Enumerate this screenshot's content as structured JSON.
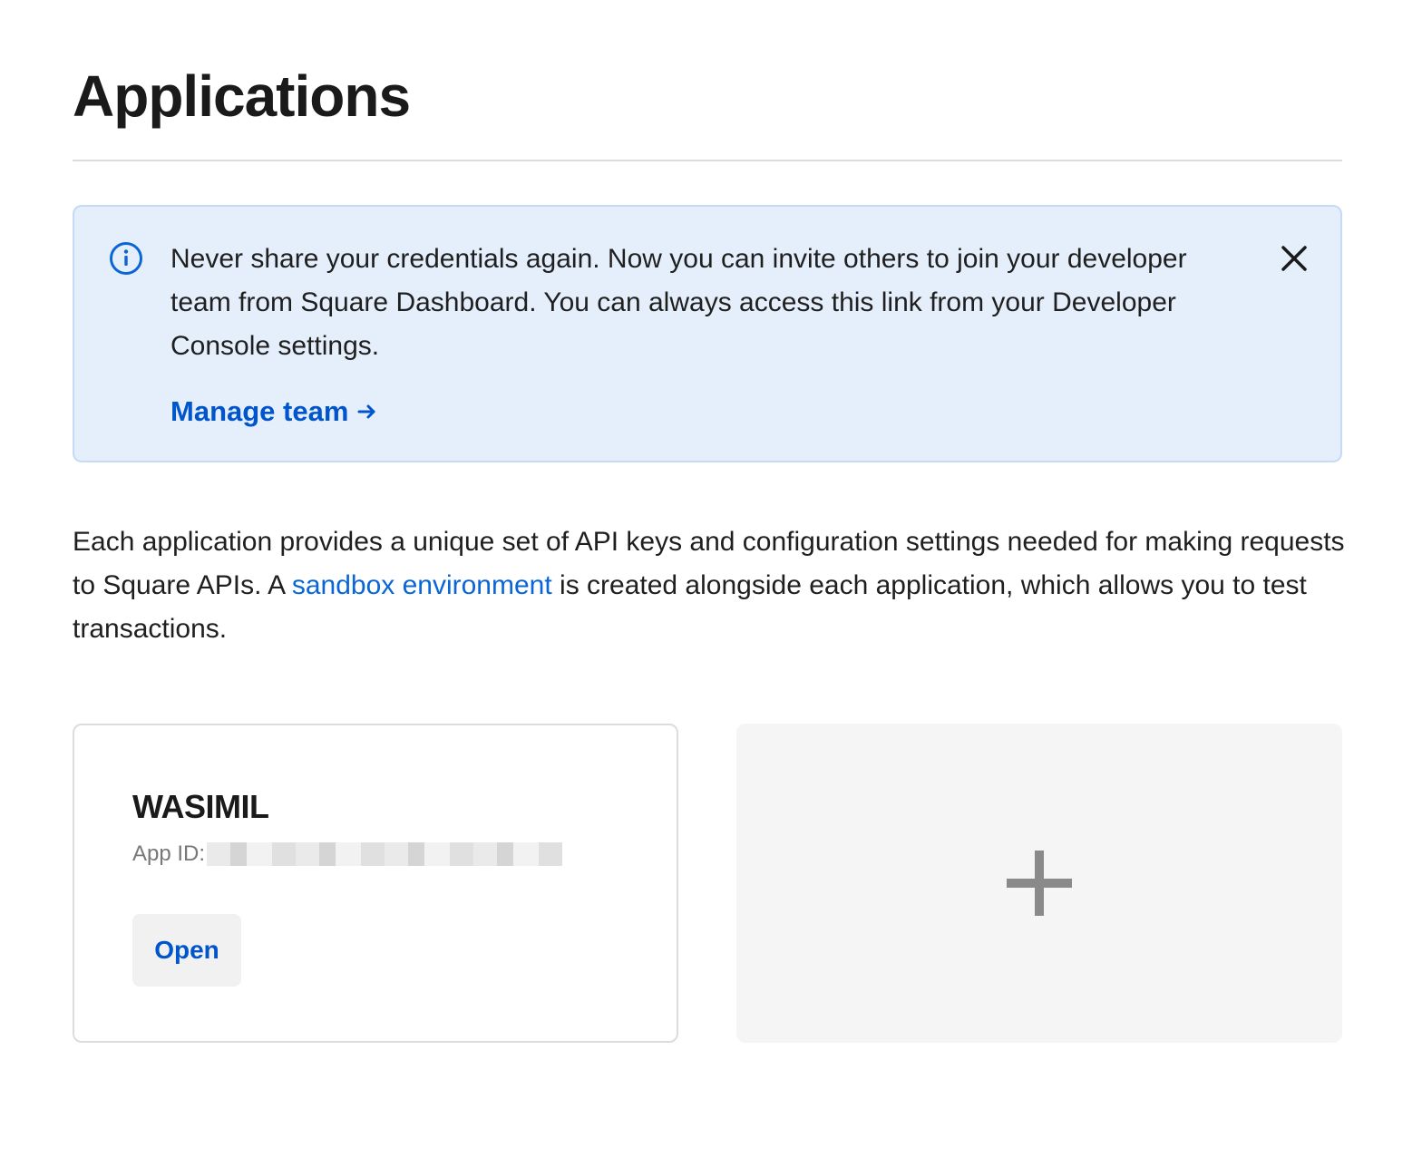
{
  "header": {
    "title": "Applications"
  },
  "banner": {
    "text": "Never share your credentials again. Now you can invite others to join your developer team from Square Dashboard. You can always access this link from your Developer Console settings.",
    "link_label": "Manage team",
    "info_icon": "info-icon",
    "close_icon": "close-icon",
    "arrow_icon": "arrow-right-icon",
    "background_color": "#e5effc",
    "accent_color": "#0055cc"
  },
  "description": {
    "text_before": "Each application provides a unique set of API keys and configuration settings needed for making requests to Square APIs. A ",
    "link_label": "sandbox environment",
    "text_after": " is created alongside each application, which allows you to test transactions."
  },
  "applications": [
    {
      "name": "WASIMIL",
      "app_id_label": "App ID:",
      "open_label": "Open"
    }
  ],
  "add_card": {
    "icon": "plus-icon"
  }
}
